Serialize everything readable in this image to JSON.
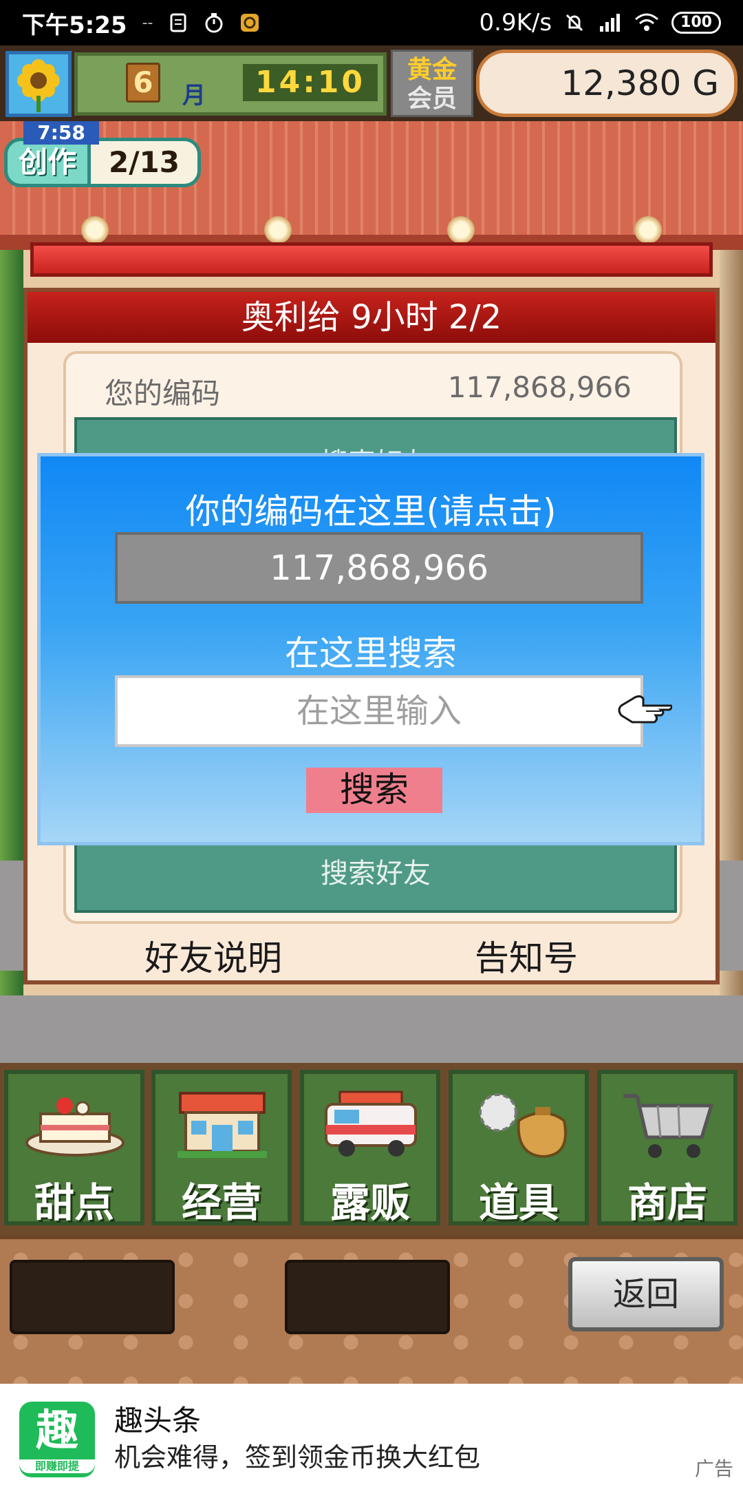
{
  "status_bar": {
    "time": "下午5:25",
    "dash": "--",
    "network_speed": "0.9K/s",
    "battery": "100"
  },
  "top_bar": {
    "month_number": "6",
    "month_label": "月",
    "clock": "14:10",
    "member_line1": "黄金",
    "member_line2": "会员",
    "money": "12,380 G"
  },
  "create_badge": {
    "timer": "7:58",
    "label": "创作",
    "count": "2/13"
  },
  "friend_dialog": {
    "header": "奥利给  9小时 2/2",
    "code_label": "您的编码",
    "code_value": "117,868,966",
    "teal_top_label": "搜索好友",
    "teal_bottom_label": "搜索好友",
    "footer_left": "好友说明",
    "footer_right": "告知号"
  },
  "search_popup": {
    "title": "你的编码在这里(请点击)",
    "code_value": "117,868,966",
    "search_label": "在这里搜索",
    "input_placeholder": "在这里输入",
    "search_button": "搜索"
  },
  "menu": [
    {
      "label": "甜点",
      "icon": "cake-icon"
    },
    {
      "label": "经营",
      "icon": "shop-icon"
    },
    {
      "label": "露贩",
      "icon": "food-truck-icon"
    },
    {
      "label": "道具",
      "icon": "item-bag-icon"
    },
    {
      "label": "商店",
      "icon": "shopping-cart-icon"
    }
  ],
  "back_button": "返回",
  "ad": {
    "logo_char": "趣",
    "logo_sub": "即赚即提",
    "title": "趣头条",
    "description": "机会难得，签到领金币换大红包",
    "tag": "广告"
  },
  "colors": {
    "popup_top": "#1088f5",
    "search_button": "#f07f8d",
    "header_red": "#c7221c"
  }
}
